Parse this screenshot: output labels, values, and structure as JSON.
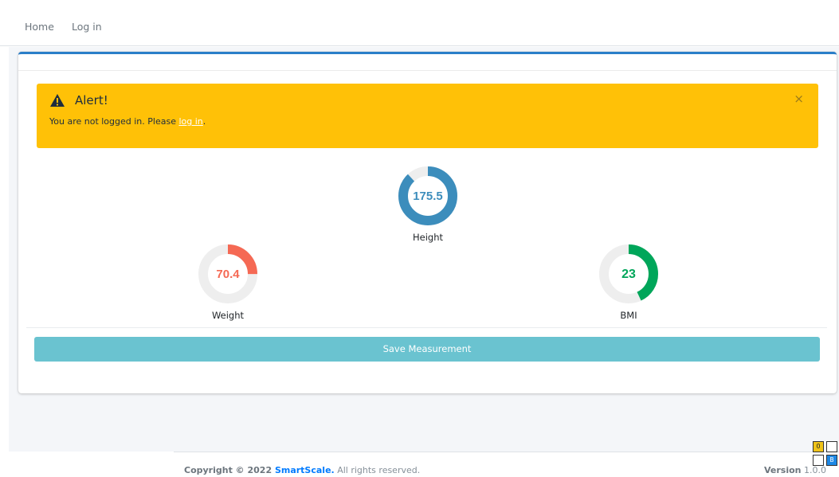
{
  "nav": {
    "home_label": "Home",
    "login_label": "Log in"
  },
  "alert": {
    "icon": "warning-triangle-icon",
    "title": "Alert!",
    "message_prefix": "You are not logged in. Please ",
    "link_text": "log in",
    "message_suffix": ".",
    "close_symbol": "×"
  },
  "gauges": {
    "height": {
      "value": "175.5",
      "label": "Height",
      "fill_fraction": 0.88,
      "color": "#3c8dbc"
    },
    "weight": {
      "value": "70.4",
      "label": "Weight",
      "fill_fraction": 0.25,
      "color": "#f56954"
    },
    "bmi": {
      "value": "23",
      "label": "BMI",
      "fill_fraction": 0.43,
      "color": "#00a65a"
    }
  },
  "save_button_label": "Save Measurement",
  "footer": {
    "copyright_prefix": "Copyright © 2022 ",
    "brand": "SmartScale.",
    "copyright_suffix": " All rights reserved.",
    "version_label": "Version",
    "version_number": " 1.0.0"
  },
  "mini_grid": {
    "cell_o": "O",
    "cell_b": "B"
  },
  "colors": {
    "accent": "#2a7ec8",
    "alert_bg": "#ffc107",
    "button_bg": "#6ac3d0",
    "track": "#eeeeee"
  }
}
